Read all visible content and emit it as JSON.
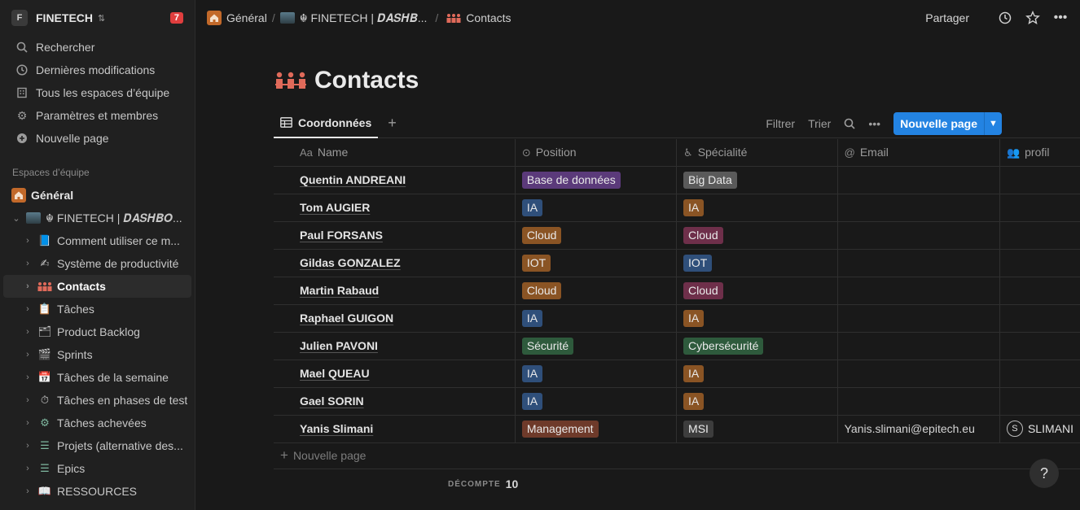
{
  "workspace": {
    "logo": "F",
    "name": "FINETECH",
    "badge": "7"
  },
  "nav": [
    {
      "label": "Rechercher",
      "icon": "search-icon"
    },
    {
      "label": "Dernières modifications",
      "icon": "clock-icon"
    },
    {
      "label": "Tous les espaces d’équipe",
      "icon": "building-icon"
    },
    {
      "label": "Paramètres et membres",
      "icon": "gear-icon"
    },
    {
      "label": "Nouvelle page",
      "icon": "plus-circle-icon"
    }
  ],
  "sidebar": {
    "section_label": "Espaces d’équipe",
    "general": "Général",
    "finetech": "☬ FINETECH | 𝑫𝑨𝑺𝑯𝑩𝑶...",
    "children": [
      {
        "label": "Comment utiliser ce m...",
        "icon": "📘"
      },
      {
        "label": "Système de productivité",
        "icon": "✍"
      },
      {
        "label": "Contacts",
        "icon": "👥",
        "active": true
      },
      {
        "label": "Tâches",
        "icon": "📋"
      },
      {
        "label": "Product Backlog",
        "icon": "🗂"
      },
      {
        "label": "Sprints",
        "icon": "🎬"
      },
      {
        "label": "Tâches de la semaine",
        "icon": "📅"
      },
      {
        "label": "Tâches en phases de test",
        "icon": "⏱"
      },
      {
        "label": "Tâches achevées",
        "icon": "⚙"
      },
      {
        "label": "Projets (alternative des...",
        "icon": "☰"
      },
      {
        "label": "Epics",
        "icon": "☰"
      },
      {
        "label": "RESSOURCES",
        "icon": "📖"
      }
    ]
  },
  "breadcrumb": {
    "general": "Général",
    "finetech": "☬ FINETECH | 𝑫𝑨𝑺𝑯𝑩...",
    "contacts": "Contacts"
  },
  "top_actions": {
    "share": "Partager"
  },
  "page": {
    "title": "Contacts"
  },
  "view": {
    "tab": "Coordonnées",
    "filter": "Filtrer",
    "sort": "Trier",
    "new_button": "Nouvelle page"
  },
  "columns": {
    "name_prefix": "Aa",
    "name": "Name",
    "position": "Position",
    "specialite": "Spécialité",
    "email": "Email",
    "profil": "profil"
  },
  "rows": [
    {
      "name": "Quentin ANDREANI",
      "position": "Base de données",
      "position_color": "#5b3a7a",
      "specialite": "Big Data",
      "specialite_color": "#5a5a5a",
      "email": "",
      "profil": ""
    },
    {
      "name": "Tom AUGIER",
      "position": "IA",
      "position_color": "#2f4f7a",
      "specialite": "IA",
      "specialite_color": "#8a5424",
      "email": "",
      "profil": ""
    },
    {
      "name": "Paul FORSANS",
      "position": "Cloud",
      "position_color": "#8a5424",
      "specialite": "Cloud",
      "specialite_color": "#6e2f4a",
      "email": "",
      "profil": ""
    },
    {
      "name": "Gildas GONZALEZ",
      "position": "IOT",
      "position_color": "#8a5424",
      "specialite": "IOT",
      "specialite_color": "#2f4f7a",
      "email": "",
      "profil": ""
    },
    {
      "name": "Martin Rabaud",
      "position": "Cloud",
      "position_color": "#8a5424",
      "specialite": "Cloud",
      "specialite_color": "#6e2f4a",
      "email": "",
      "profil": ""
    },
    {
      "name": "Raphael GUIGON",
      "position": "IA",
      "position_color": "#2f4f7a",
      "specialite": "IA",
      "specialite_color": "#8a5424",
      "email": "",
      "profil": ""
    },
    {
      "name": "Julien PAVONI",
      "position": "Sécurité",
      "position_color": "#2e5a3c",
      "specialite": "Cybersécurité",
      "specialite_color": "#2e5a3c",
      "email": "",
      "profil": ""
    },
    {
      "name": "Mael QUEAU",
      "position": "IA",
      "position_color": "#2f4f7a",
      "specialite": "IA",
      "specialite_color": "#8a5424",
      "email": "",
      "profil": ""
    },
    {
      "name": "Gael SORIN",
      "position": "IA",
      "position_color": "#2f4f7a",
      "specialite": "IA",
      "specialite_color": "#8a5424",
      "email": "",
      "profil": ""
    },
    {
      "name": "Yanis Slimani",
      "position": "Management",
      "position_color": "#6e3a2a",
      "specialite": "MSI",
      "specialite_color": "#3d3d3d",
      "email": "Yanis.slimani@epitech.eu",
      "profil": "SLIMANI",
      "profil_avatar": "S"
    }
  ],
  "footer": {
    "new_row": "Nouvelle page",
    "count_label": "DÉCOMPTE",
    "count_value": "10"
  },
  "help": "?"
}
